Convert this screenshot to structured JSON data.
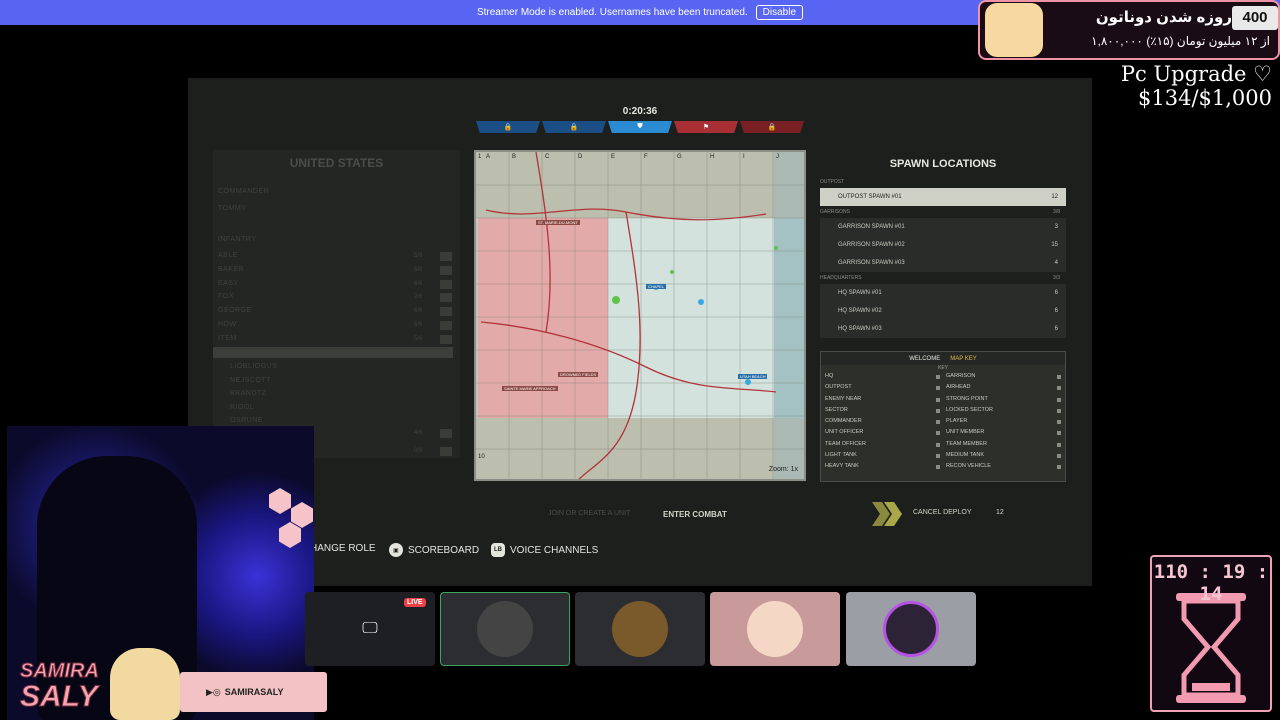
{
  "banner": {
    "message": "Streamer Mode is enabled. Usernames have been truncated.",
    "disable_label": "Disable"
  },
  "game": {
    "timer": "0:20:36",
    "faction": "UNITED STATES",
    "commander_label": "COMMANDER",
    "commander_name": "TOMMY",
    "infantry_label": "INFANTRY",
    "units": [
      {
        "name": "ABLE",
        "count": "5/6"
      },
      {
        "name": "BAKER",
        "count": "5/6"
      },
      {
        "name": "EASY",
        "count": "6/6"
      },
      {
        "name": "FOX",
        "count": "2/6"
      },
      {
        "name": "GEORGE",
        "count": "6/6"
      },
      {
        "name": "HOW",
        "count": "6/6"
      },
      {
        "name": "ITEM",
        "count": "5/6"
      }
    ],
    "members": [
      "LIOBLIOGUS",
      "NEJSCOTT",
      "BRANDTZ",
      "RIOOL",
      "OSRUNE"
    ],
    "bottom_counts": [
      "4/6",
      "0/6"
    ],
    "map": {
      "columns": [
        "A",
        "B",
        "C",
        "D",
        "E",
        "F",
        "G",
        "H",
        "I",
        "J"
      ],
      "row_first": "1",
      "row_last": "10",
      "zoom": "Zoom: 1x",
      "labels": [
        "ST. MARIE-DU-MONT",
        "SAINTE MARIE APPROACH",
        "DROWNED FIELDS",
        "UTAH BEACH",
        "CHAPEL"
      ]
    },
    "spawn": {
      "title": "SPAWN LOCATIONS",
      "groups": [
        {
          "label": "OUTPOST",
          "count": "",
          "rows": [
            {
              "name": "OUTPOST SPAWN #01",
              "count": "12",
              "selected": true
            }
          ]
        },
        {
          "label": "GARRISONS",
          "count": "3/8",
          "rows": [
            {
              "name": "GARRISON SPAWN #01",
              "count": "3",
              "selected": false
            },
            {
              "name": "GARRISON SPAWN #02",
              "count": "15",
              "selected": false
            },
            {
              "name": "GARRISON SPAWN #03",
              "count": "4",
              "selected": false
            }
          ]
        },
        {
          "label": "HEADQUARTERS",
          "count": "3/3",
          "rows": [
            {
              "name": "HQ SPAWN #01",
              "count": "6",
              "selected": false
            },
            {
              "name": "HQ SPAWN #02",
              "count": "6",
              "selected": false
            },
            {
              "name": "HQ SPAWN #03",
              "count": "6",
              "selected": false
            }
          ]
        }
      ]
    },
    "key": {
      "tab_welcome": "WELCOME",
      "tab_mapkey": "MAP KEY",
      "title": "KEY",
      "left": [
        "HQ",
        "OUTPOST",
        "ENEMY NEAR",
        "SECTOR",
        "COMMANDER",
        "UNIT OFFICER",
        "TEAM OFFICER",
        "LIGHT TANK",
        "HEAVY TANK"
      ],
      "right": [
        "GARRISON",
        "AIRHEAD",
        "STRONG POINT",
        "LOCKED SECTOR",
        "PLAYER",
        "UNIT MEMBER",
        "TEAM MEMBER",
        "MEDIUM TANK",
        "RECON VEHICLE"
      ]
    },
    "join_unit": "JOIN OR CREATE A UNIT",
    "enter_combat": "ENTER COMBAT",
    "cancel_deploy": "CANCEL DEPLOY",
    "deploy_timer": "12",
    "hints": {
      "change_role": "HANGE ROLE",
      "scoreboard": "SCOREBOARD",
      "voice": "VOICE CHANNELS",
      "voice_glyph": "LB"
    }
  },
  "stream": {
    "handle": "SAMIRASALY",
    "name_line1": "SAMIRA",
    "name_line2": "SALY",
    "live_badge": "LIVE",
    "donation_title": "روزه شدن دوناتون",
    "donation_count": "400",
    "donation_progress": "۱,۸۰۰,۰۰۰ از ۱۲ میلیون تومان (۱۵٪)",
    "upgrade": "Pc Upgrade ♡ $134/$1,000",
    "countdown": "110 : 19 : 14"
  },
  "colors": {
    "discord_blurple": "#5865f2",
    "accent_pink": "#f093a4",
    "team_blue": "#1f72b8",
    "team_red": "#b2333a"
  }
}
